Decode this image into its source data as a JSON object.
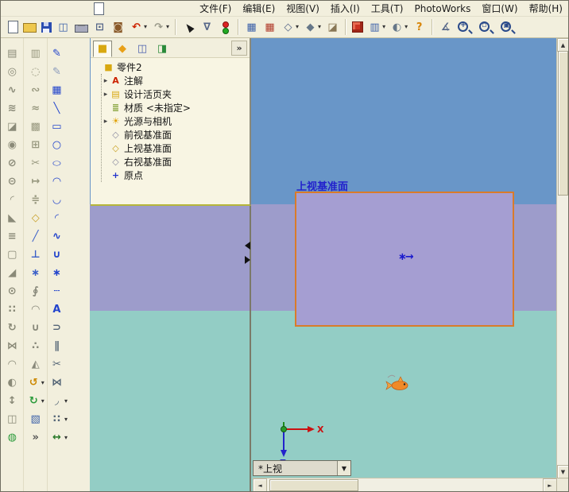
{
  "glyphs": {
    "caret": "▾",
    "down": "▼",
    "left": "◄",
    "right": "►",
    "up": "▲",
    "expand": "»"
  },
  "menu": {
    "items": [
      {
        "n": "file",
        "label": "文件(F)"
      },
      {
        "n": "edit",
        "label": "编辑(E)"
      },
      {
        "n": "view",
        "label": "视图(V)"
      },
      {
        "n": "insert",
        "label": "插入(I)"
      },
      {
        "n": "tools",
        "label": "工具(T)"
      },
      {
        "n": "photoworks",
        "label": "PhotoWorks"
      },
      {
        "n": "window",
        "label": "窗口(W)"
      },
      {
        "n": "help",
        "label": "帮助(H)"
      }
    ]
  },
  "toolbars": {
    "main": [
      {
        "n": "new-document",
        "shape": "page"
      },
      {
        "n": "open-document",
        "shape": "folder"
      },
      {
        "n": "save",
        "shape": "floppy"
      },
      {
        "n": "make-drawing-from-part",
        "g": "◫",
        "c": "#3a5fa8"
      },
      {
        "n": "print",
        "shape": "printer"
      },
      {
        "n": "print-preview",
        "g": "⊡",
        "c": "#556688"
      },
      {
        "n": "photoworks-render",
        "g": "◙",
        "c": "#8a5a2a"
      },
      {
        "n": "undo",
        "g": "↶",
        "c": "#cc2200",
        "caret": true
      },
      {
        "n": "redo",
        "g": "↷",
        "c": "#9a9a8a",
        "caret": true
      },
      {
        "sep": true
      },
      {
        "n": "select",
        "shape": "cursor"
      },
      {
        "n": "selection-filter",
        "g": "∇",
        "c": "#556688"
      },
      {
        "n": "rebuild",
        "shape": "lights"
      },
      {
        "sep": true
      },
      {
        "n": "grid-settings",
        "g": "▦",
        "c": "#3a5fa8"
      },
      {
        "n": "material-editor",
        "g": "▦",
        "c": "#b03a2a"
      },
      {
        "n": "view-orientation",
        "g": "◇",
        "c": "#556688",
        "caret": true
      },
      {
        "n": "display-style",
        "g": "◆",
        "c": "#667788",
        "caret": true
      },
      {
        "n": "section-view",
        "g": "◪",
        "c": "#887755"
      },
      {
        "sep": true
      },
      {
        "n": "isometric-view",
        "shape": "cube"
      },
      {
        "n": "standard-views",
        "g": "▥",
        "c": "#3a5fa8",
        "caret": true
      },
      {
        "n": "lighting",
        "g": "◐",
        "c": "#667788",
        "caret": true
      },
      {
        "n": "help",
        "g": "?",
        "c": "#d8860a"
      },
      {
        "sep": true
      },
      {
        "n": "measure",
        "g": "∡",
        "c": "#556688"
      },
      {
        "n": "zoom-in",
        "shape": "lens",
        "g": "+"
      },
      {
        "n": "zoom-to-area",
        "shape": "lens",
        "g": "▫"
      },
      {
        "n": "zoom-to-fit",
        "shape": "lens",
        "g": "▣"
      }
    ],
    "features": [
      {
        "n": "extruded-boss",
        "g": "▤",
        "c": "#8a8a78"
      },
      {
        "n": "revolved-boss",
        "g": "◎",
        "c": "#8a8a78"
      },
      {
        "n": "swept-boss",
        "g": "∿",
        "c": "#8a8a78"
      },
      {
        "n": "lofted-boss",
        "g": "≋",
        "c": "#8a8a78"
      },
      {
        "n": "extruded-cut",
        "g": "◪",
        "c": "#8a8a78"
      },
      {
        "n": "revolved-cut",
        "g": "◉",
        "c": "#8a8a78"
      },
      {
        "n": "swept-cut",
        "g": "⊘",
        "c": "#8a8a78"
      },
      {
        "n": "lofted-cut",
        "g": "⊝",
        "c": "#8a8a78"
      },
      {
        "n": "fillet",
        "g": "◜",
        "c": "#8a8a78"
      },
      {
        "n": "chamfer",
        "g": "◣",
        "c": "#8a8a78"
      },
      {
        "n": "rib",
        "g": "≡",
        "c": "#8a8a78"
      },
      {
        "n": "shell",
        "g": "▢",
        "c": "#8a8a78"
      },
      {
        "n": "draft",
        "g": "◢",
        "c": "#8a8a78"
      },
      {
        "n": "hole-wizard",
        "g": "⊙",
        "c": "#8a8a78"
      },
      {
        "n": "linear-pattern",
        "g": "∷",
        "c": "#8a8a78"
      },
      {
        "n": "circular-pattern",
        "g": "↻",
        "c": "#8a8a78"
      },
      {
        "n": "mirror-feature",
        "g": "⋈",
        "c": "#8a8a78"
      },
      {
        "n": "dome",
        "g": "◠",
        "c": "#8a8a78"
      },
      {
        "n": "shape-feature",
        "g": "◐",
        "c": "#8a8a78"
      },
      {
        "n": "scale",
        "g": "↕",
        "c": "#8a8a78"
      },
      {
        "n": "split",
        "g": "◫",
        "c": "#8a8a78"
      },
      {
        "n": "join",
        "g": "◍",
        "c": "#2a9a3a"
      }
    ],
    "tools": [
      {
        "n": "extruded-surface",
        "g": "▥",
        "c": "#98987f"
      },
      {
        "n": "revolved-surface",
        "g": "◌",
        "c": "#98987f"
      },
      {
        "n": "swept-surface",
        "g": "∾",
        "c": "#98987f"
      },
      {
        "n": "lofted-surface",
        "g": "≈",
        "c": "#98987f"
      },
      {
        "n": "planar-surface",
        "g": "▩",
        "c": "#98987f"
      },
      {
        "n": "knit-surface",
        "g": "⊞",
        "c": "#98987f"
      },
      {
        "n": "trim-surface",
        "g": "✂",
        "c": "#98987f"
      },
      {
        "n": "extend-surface",
        "g": "↦",
        "c": "#98987f"
      },
      {
        "n": "offset-surface",
        "g": "≑",
        "c": "#98987f"
      },
      {
        "n": "reference-plane",
        "g": "◇",
        "c": "#c8a028"
      },
      {
        "n": "reference-axis",
        "g": "╱",
        "c": "#3a5fc8"
      },
      {
        "n": "coordinate-system",
        "g": "⊥",
        "c": "#3a5fc8"
      },
      {
        "n": "reference-point",
        "g": "∗",
        "c": "#3a5fc8"
      },
      {
        "n": "helix-curve",
        "g": "∮",
        "c": "#88887a"
      },
      {
        "n": "projected-curve",
        "g": "◠",
        "c": "#88887a"
      },
      {
        "n": "composite-curve",
        "g": "∪",
        "c": "#88887a"
      },
      {
        "n": "curve-through-points",
        "g": "∴",
        "c": "#88887a"
      },
      {
        "n": "split-line",
        "g": "◭",
        "c": "#88887a"
      },
      {
        "n": "rotate-view",
        "g": "↺",
        "c": "#cc8800",
        "caret": true
      },
      {
        "n": "pan-view",
        "g": "↻",
        "c": "#2a9a3a",
        "caret": true
      },
      {
        "n": "texture",
        "g": "▧",
        "c": "#3a5fa8"
      },
      {
        "n": "toolbar-more",
        "g": "»",
        "c": "#555555"
      }
    ],
    "sketch": [
      {
        "n": "sketch",
        "g": "✎",
        "c": "#2244cc"
      },
      {
        "n": "3d-sketch",
        "g": "✎",
        "c": "#8899bb"
      },
      {
        "n": "sketch-grid",
        "g": "▦",
        "c": "#2244cc"
      },
      {
        "n": "sketch-line",
        "g": "╲",
        "c": "#2244cc"
      },
      {
        "n": "sketch-rectangle",
        "g": "▭",
        "c": "#2244cc"
      },
      {
        "n": "sketch-circle",
        "g": "○",
        "c": "#2244cc"
      },
      {
        "n": "sketch-ellipse",
        "g": "○",
        "c": "#2244cc",
        "cls": "squish"
      },
      {
        "n": "centerpoint-arc",
        "g": "◠",
        "c": "#2244cc"
      },
      {
        "n": "tangent-arc",
        "g": "◡",
        "c": "#2244cc"
      },
      {
        "n": "three-point-arc",
        "g": "◜",
        "c": "#2244cc"
      },
      {
        "n": "sketch-spline",
        "g": "∿",
        "c": "#2244cc"
      },
      {
        "n": "sketch-parabola",
        "g": "∪",
        "c": "#2244cc"
      },
      {
        "n": "sketch-point",
        "g": "∗",
        "c": "#2244cc"
      },
      {
        "n": "sketch-centerline",
        "g": "┄",
        "c": "#2244cc"
      },
      {
        "n": "sketch-text",
        "g": "A",
        "c": "#2244cc"
      },
      {
        "n": "convert-entities",
        "g": "⊃",
        "c": "#556677"
      },
      {
        "n": "offset-entities",
        "g": "∥",
        "c": "#556677"
      },
      {
        "n": "trim-entities",
        "g": "✂",
        "c": "#556677"
      },
      {
        "n": "mirror-entities",
        "g": "⋈",
        "c": "#556677"
      },
      {
        "n": "sketch-fillet",
        "g": "◞",
        "c": "#556677",
        "caret": true
      },
      {
        "n": "linear-sketch-pattern",
        "g": "∷",
        "c": "#556677",
        "caret": true
      },
      {
        "n": "smart-dimension",
        "g": "↔",
        "c": "#2a7a2a",
        "caret": true
      }
    ]
  },
  "panel": {
    "tabs": [
      {
        "n": "featuremanager",
        "g": "■",
        "c": "#d8a810",
        "active": true
      },
      {
        "n": "propertymanager",
        "g": "◆",
        "c": "#e8a018"
      },
      {
        "n": "configurationmanager",
        "g": "◫",
        "c": "#4a5fae"
      },
      {
        "n": "addins",
        "g": "◨",
        "c": "#2a8a3a"
      }
    ],
    "expand_label": "»",
    "tree": {
      "root": "零件2",
      "root_icon": {
        "g": "■",
        "c": "#d8a810"
      },
      "items": [
        {
          "n": "annotations",
          "label": "注解",
          "g": "A",
          "c": "#cc2200",
          "expand": true
        },
        {
          "n": "design-binder",
          "label": "设计活页夹",
          "g": "▤",
          "c": "#d8a810",
          "expand": true
        },
        {
          "n": "material",
          "label": "材质 <未指定>",
          "g": "≣",
          "c": "#7a9a2a",
          "expand": false
        },
        {
          "n": "lights-cameras",
          "label": "光源与相机",
          "g": "☀",
          "c": "#e0a000",
          "expand": true
        },
        {
          "n": "front-plane",
          "label": "前视基准面",
          "g": "◇",
          "c": "#8a8aa0",
          "expand": false
        },
        {
          "n": "top-plane",
          "label": "上视基准面",
          "g": "◇",
          "c": "#c8a020",
          "expand": false
        },
        {
          "n": "right-plane",
          "label": "右视基准面",
          "g": "◇",
          "c": "#8a8aa0",
          "expand": false
        },
        {
          "n": "origin",
          "label": "原点",
          "g": "+",
          "c": "#2233cc",
          "expand": false
        }
      ]
    }
  },
  "viewport": {
    "plane_label": "上视基准面",
    "origin_glyph": "∗→",
    "view_combo": "*上视",
    "colors": {
      "sky": "#6996c8",
      "horizon": "#9d9ccb",
      "ground": "#93cdc5",
      "plane_fill": "#a59ed2",
      "plane_border": "#d97b2a",
      "label": "#2222cc"
    }
  },
  "triad": {
    "x": "X",
    "z": "Z"
  }
}
